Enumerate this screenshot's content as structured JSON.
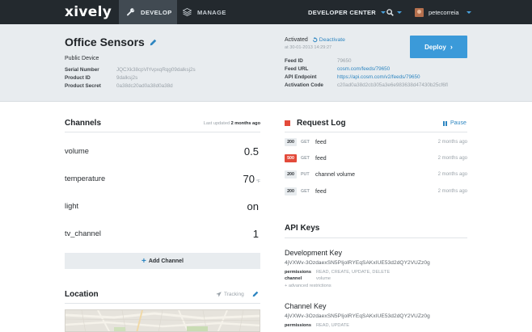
{
  "nav": {
    "logo": "xively",
    "develop": "DEVELOP",
    "manage": "MANAGE",
    "developer_center": "DEVELOPER CENTER",
    "username": "petecorreia",
    "accent": "#3b9ad9"
  },
  "device": {
    "title": "Office Sensors",
    "visibility": "Public Device",
    "serial_number_label": "Serial Number",
    "serial_number": "JQCXk38cpVlYvpxqRqg09dalksj2s",
    "product_id_label": "Product ID",
    "product_id": "9dalksj2s",
    "product_secret_label": "Product Secret",
    "product_secret": "0a38dc20ad0a38d0a38d",
    "status": "Activated",
    "deactivate": "Deactivate",
    "activated_at": "at 30-01-2013 14:29:27",
    "feed_id_label": "Feed ID",
    "feed_id": "79650",
    "feed_url_label": "Feed URL",
    "feed_url": "cosm.com/feeds/79650",
    "api_endpoint_label": "API Endpoint",
    "api_endpoint": "https://api.cosm.com/v2/feeds/79650",
    "activation_code_label": "Activation Code",
    "activation_code": "c20ad0a38d2cb305a3e6e983638d47430b25cf6fl",
    "deploy": "Deploy"
  },
  "channels": {
    "title": "Channels",
    "last_updated_prefix": "Last updated",
    "last_updated": "2 months ago",
    "items": [
      {
        "name": "volume",
        "value": "0.5",
        "unit": ""
      },
      {
        "name": "temperature",
        "value": "70",
        "unit": "°F"
      },
      {
        "name": "light",
        "value": "on",
        "unit": ""
      },
      {
        "name": "tv_channel",
        "value": "1",
        "unit": ""
      }
    ],
    "add": "Add Channel"
  },
  "location": {
    "title": "Location",
    "tracking": "Tracking"
  },
  "request_log": {
    "title": "Request Log",
    "pause": "Pause",
    "rows": [
      {
        "status": "200",
        "method": "GET",
        "resource": "feed",
        "ago": "2 months ago",
        "error": false
      },
      {
        "status": "500",
        "method": "GET",
        "resource": "feed",
        "ago": "2 months ago",
        "error": true
      },
      {
        "status": "200",
        "method": "PUT",
        "resource": "channel volume",
        "ago": "2 months ago",
        "error": false
      },
      {
        "status": "200",
        "method": "GET",
        "resource": "feed",
        "ago": "2 months ago",
        "error": false
      }
    ]
  },
  "api_keys": {
    "title": "API Keys",
    "keys": [
      {
        "name": "Development Key",
        "key": "4jVXWv-3OzdaexSN5PIjolRYEqSAKxIUE53d2dQY2VUZz0g",
        "permissions_label": "permissions",
        "permissions": "READ, CREATE, UPDATE, DELETE",
        "channel_label": "channel",
        "channel": "volume",
        "advanced": "+ advanced restrictions"
      },
      {
        "name": "Channel Key",
        "key": "4jVXWv-3OzdaexSN5PIjolRYEqSAKxIUE53d2dQY2VUZz0g",
        "permissions_label": "permissions",
        "permissions": "READ, UPDATE"
      }
    ]
  }
}
